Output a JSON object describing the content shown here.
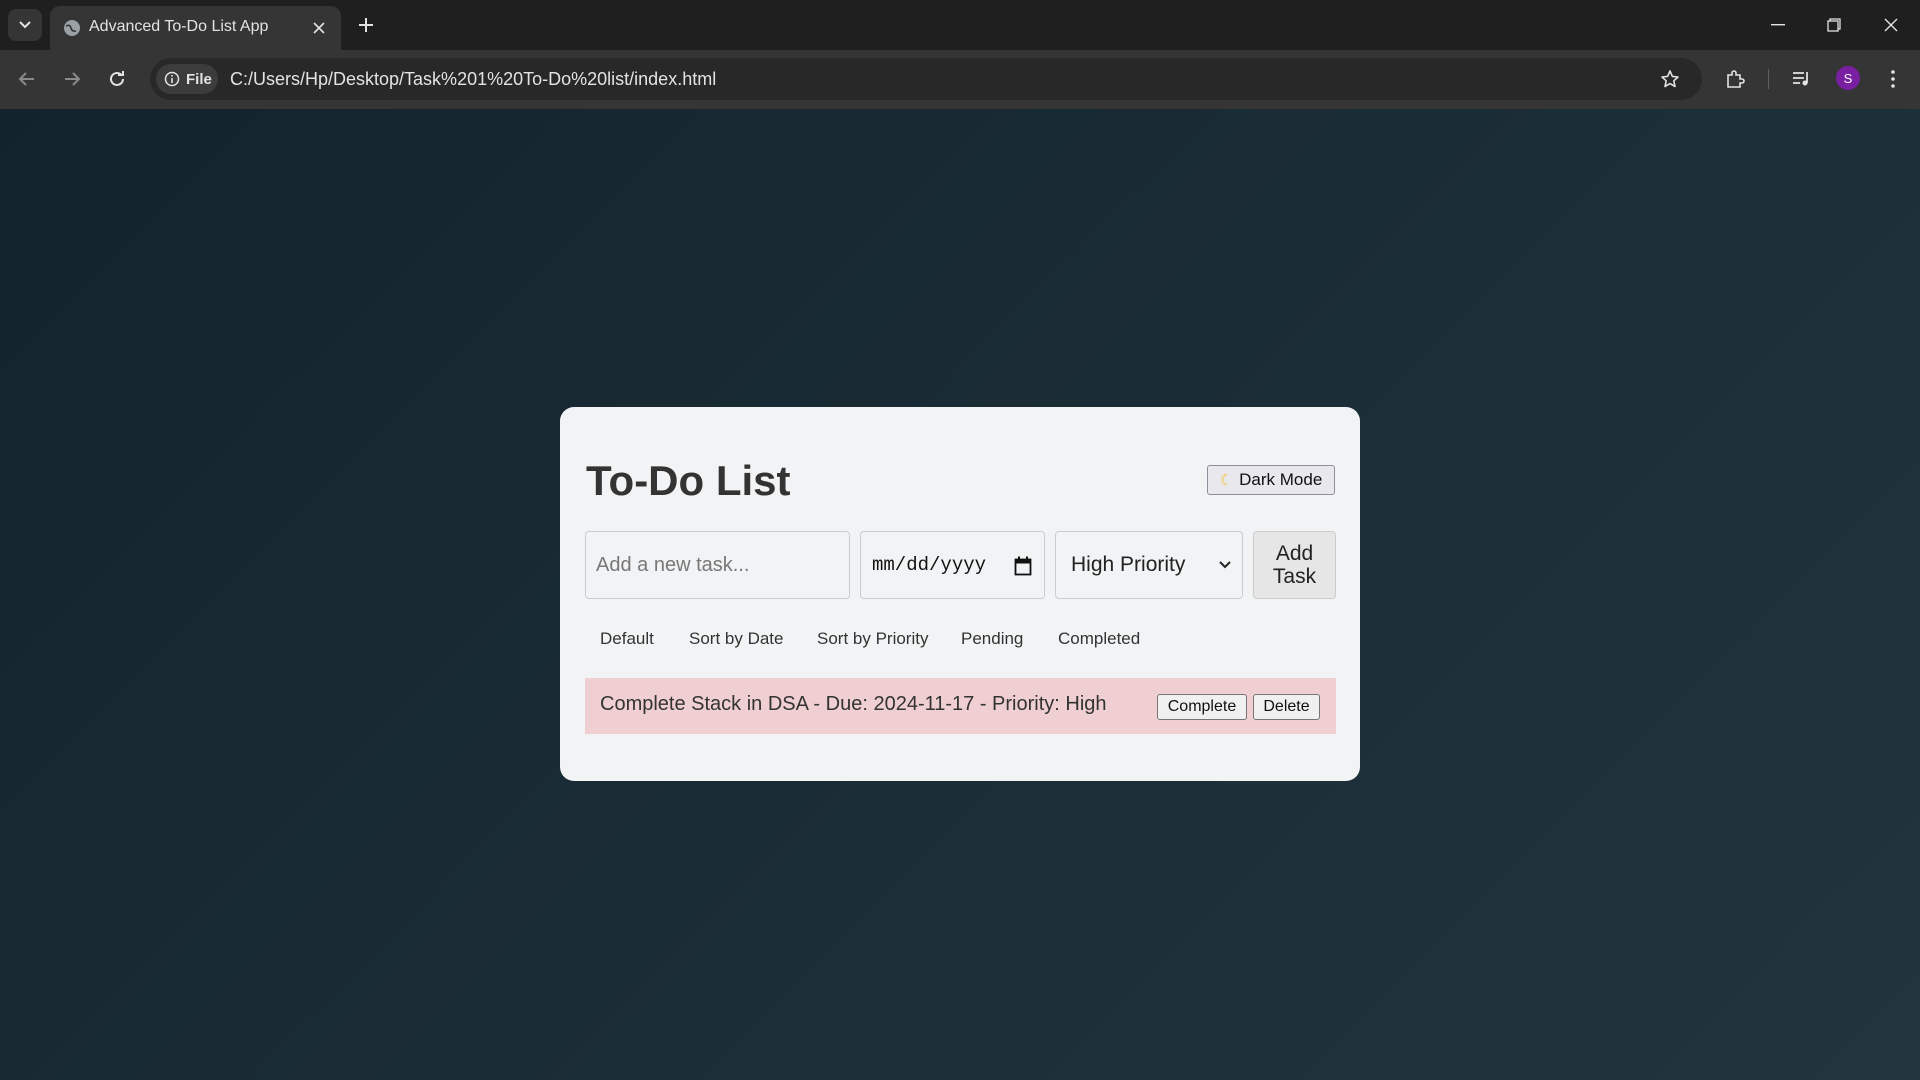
{
  "browser": {
    "tab_title": "Advanced To-Do List App",
    "file_chip": "File",
    "url": "C:/Users/Hp/Desktop/Task%201%20To-Do%20list/index.html",
    "profile_initial": "S"
  },
  "app": {
    "title": "To-Do List",
    "dark_mode_label": "Dark Mode",
    "task_placeholder": "Add a new task...",
    "date_placeholder": "mm/dd/yyyy",
    "priority_selected": "High Priority",
    "add_button": "Add\nTask",
    "filters": [
      "Default",
      "Sort by Date",
      "Sort by Priority",
      "Pending",
      "Completed"
    ],
    "tasks": [
      {
        "text": "Complete Stack in DSA - Due: 2024-11-17 - Priority: High",
        "complete_label": "Complete",
        "delete_label": "Delete"
      }
    ]
  },
  "colors": {
    "page_bg": "#1b2d36",
    "card_bg": "#f1f3f4",
    "task_high_bg": "#efcfd2",
    "avatar": "#7b1fa2"
  }
}
